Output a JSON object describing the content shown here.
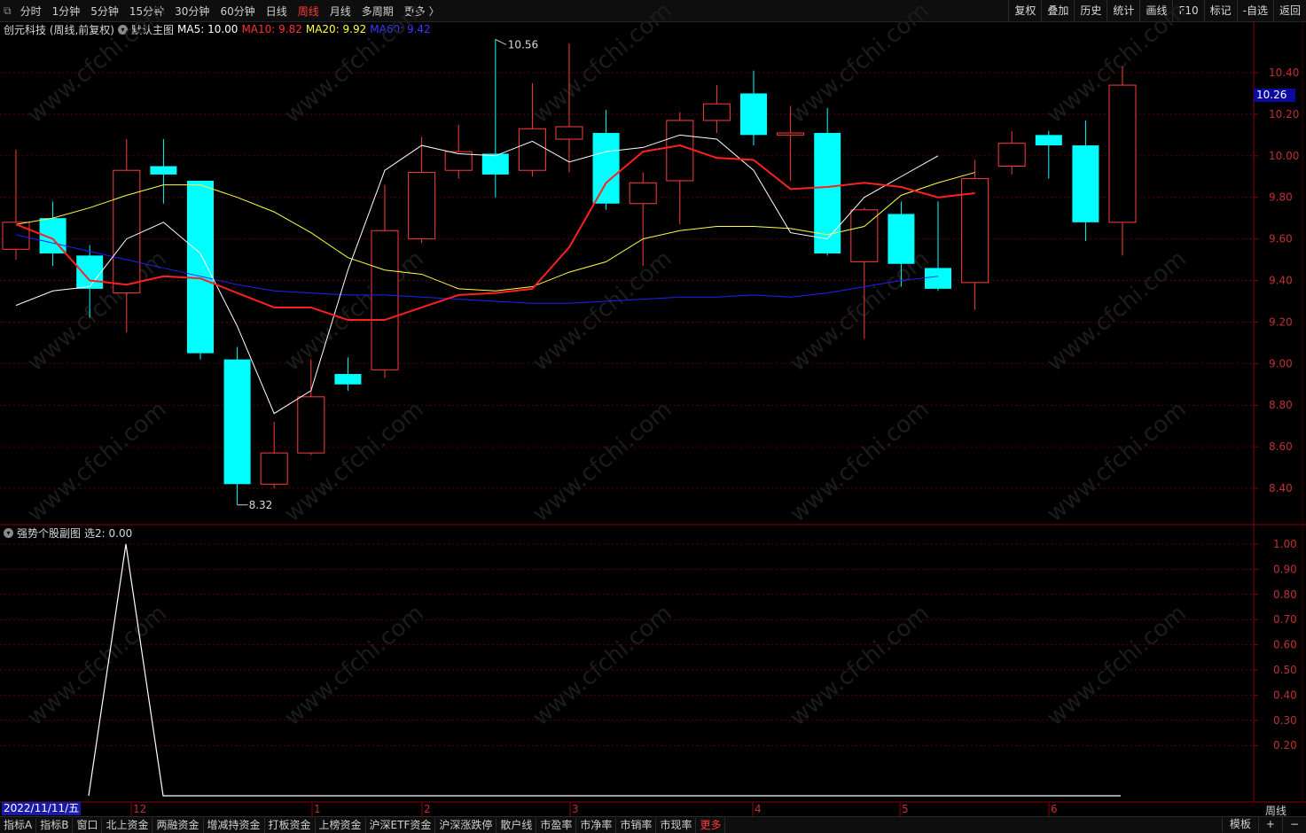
{
  "topbar": {
    "tabs": [
      "分时",
      "1分钟",
      "5分钟",
      "15分钟",
      "30分钟",
      "60分钟",
      "日线",
      "周线",
      "月线",
      "多周期",
      "更多 〉"
    ],
    "active_tab": "周线",
    "right_buttons": [
      "复权",
      "叠加",
      "历史",
      "统计",
      "画线",
      "F10",
      "标记",
      "-自选",
      "返回"
    ]
  },
  "legend": {
    "stock": "创元科技 (周线,前复权)",
    "template": "默认主图",
    "ma5": "MA5: 10.00",
    "ma10": "MA10: 9.82",
    "ma20": "MA20: 9.92",
    "ma60": "MA60: 9.42"
  },
  "sub_legend": {
    "name": "强势个股副图",
    "value": "选2: 0.00"
  },
  "current_price": "10.26",
  "high_label": "10.56",
  "low_label": "8.32",
  "date_cursor": "2022/11/11/五",
  "freq": "周线",
  "bottom_tabs": [
    "指标A",
    "指标B",
    "窗口",
    "北上资金",
    "两融资金",
    "增减持资金",
    "打板资金",
    "上榜资金",
    "沪深ETF资金",
    "沪深涨跌停",
    "散户线",
    "市盈率",
    "市净率",
    "市销率",
    "市现率",
    "更多"
  ],
  "bottom_right": [
    "模板",
    "+",
    "−"
  ],
  "colors": {
    "up": "#ff3b3b",
    "down": "#00ffff",
    "ma5": "#ffffff",
    "ma10": "#ff2020",
    "ma20": "#ffff40",
    "ma60": "#2020ff",
    "grid": "#5a0000"
  },
  "chart_data": {
    "type": "candlestick",
    "y_ticks": [
      "10.40",
      "10.20",
      "10.00",
      "9.80",
      "9.60",
      "9.40",
      "9.20",
      "9.00",
      "8.80",
      "8.60",
      "8.40"
    ],
    "x_ticks": [
      "12",
      "1",
      "2",
      "3",
      "4",
      "5",
      "6"
    ],
    "candles": [
      {
        "o": 9.55,
        "c": 9.68,
        "h": 10.03,
        "l": 9.5
      },
      {
        "o": 9.7,
        "c": 9.53,
        "h": 9.78,
        "l": 9.47
      },
      {
        "o": 9.52,
        "c": 9.36,
        "h": 9.57,
        "l": 9.22
      },
      {
        "o": 9.34,
        "c": 9.93,
        "h": 10.08,
        "l": 9.15
      },
      {
        "o": 9.95,
        "c": 9.91,
        "h": 10.08,
        "l": 9.77
      },
      {
        "o": 9.88,
        "c": 9.05,
        "h": 9.88,
        "l": 9.02
      },
      {
        "o": 9.02,
        "c": 8.42,
        "h": 9.08,
        "l": 8.32
      },
      {
        "o": 8.42,
        "c": 8.57,
        "h": 8.72,
        "l": 8.4
      },
      {
        "o": 8.57,
        "c": 8.84,
        "h": 9.02,
        "l": 8.56
      },
      {
        "o": 8.95,
        "c": 8.9,
        "h": 9.03,
        "l": 8.87
      },
      {
        "o": 8.97,
        "c": 9.64,
        "h": 9.86,
        "l": 8.93
      },
      {
        "o": 9.6,
        "c": 9.92,
        "h": 10.09,
        "l": 9.58
      },
      {
        "o": 9.93,
        "c": 10.02,
        "h": 10.15,
        "l": 9.89
      },
      {
        "o": 10.01,
        "c": 9.91,
        "h": 10.56,
        "l": 9.8
      },
      {
        "o": 9.93,
        "c": 10.13,
        "h": 10.35,
        "l": 9.9
      },
      {
        "o": 10.08,
        "c": 10.14,
        "h": 10.54,
        "l": 9.92
      },
      {
        "o": 10.11,
        "c": 9.77,
        "h": 10.22,
        "l": 9.74
      },
      {
        "o": 9.77,
        "c": 9.87,
        "h": 9.92,
        "l": 9.47
      },
      {
        "o": 9.88,
        "c": 10.17,
        "h": 10.21,
        "l": 9.67
      },
      {
        "o": 10.17,
        "c": 10.25,
        "h": 10.34,
        "l": 10.11
      },
      {
        "o": 10.3,
        "c": 10.1,
        "h": 10.41,
        "l": 10.05
      },
      {
        "o": 10.1,
        "c": 10.11,
        "h": 10.24,
        "l": 9.88
      },
      {
        "o": 10.11,
        "c": 9.53,
        "h": 10.23,
        "l": 9.52
      },
      {
        "o": 9.49,
        "c": 9.74,
        "h": 9.75,
        "l": 9.12
      },
      {
        "o": 9.72,
        "c": 9.48,
        "h": 9.78,
        "l": 9.37
      },
      {
        "o": 9.46,
        "c": 9.36,
        "h": 9.78,
        "l": 9.35
      },
      {
        "o": 9.39,
        "c": 9.89,
        "h": 9.98,
        "l": 9.26
      },
      {
        "o": 9.95,
        "c": 10.06,
        "h": 10.12,
        "l": 9.91
      },
      {
        "o": 10.1,
        "c": 10.05,
        "h": 10.12,
        "l": 9.89
      },
      {
        "o": 10.05,
        "c": 9.68,
        "h": 10.17,
        "l": 9.59
      },
      {
        "o": 9.68,
        "c": 10.34,
        "h": 10.43,
        "l": 9.52
      }
    ],
    "ma5": [
      9.28,
      9.35,
      9.37,
      9.6,
      9.68,
      9.53,
      9.18,
      8.76,
      8.87,
      9.45,
      9.93,
      10.05,
      10.01,
      10.0,
      10.07,
      9.97,
      10.02,
      10.04,
      10.1,
      10.08,
      9.93,
      9.63,
      9.6,
      9.8,
      9.9,
      10.0
    ],
    "ma10": [
      9.67,
      9.6,
      9.4,
      9.38,
      9.42,
      9.41,
      9.34,
      9.27,
      9.27,
      9.21,
      9.21,
      9.27,
      9.33,
      9.34,
      9.36,
      9.56,
      9.87,
      10.02,
      10.05,
      9.99,
      9.98,
      9.84,
      9.85,
      9.87,
      9.85,
      9.8,
      9.82
    ],
    "ma20": [
      9.67,
      9.7,
      9.75,
      9.81,
      9.86,
      9.86,
      9.8,
      9.73,
      9.63,
      9.51,
      9.45,
      9.43,
      9.36,
      9.35,
      9.37,
      9.44,
      9.49,
      9.6,
      9.64,
      9.66,
      9.66,
      9.65,
      9.62,
      9.66,
      9.81,
      9.87,
      9.92
    ],
    "ma60": [
      9.62,
      9.58,
      9.54,
      9.5,
      9.46,
      9.42,
      9.38,
      9.35,
      9.34,
      9.33,
      9.33,
      9.32,
      9.31,
      9.3,
      9.29,
      9.29,
      9.3,
      9.31,
      9.32,
      9.32,
      9.33,
      9.32,
      9.34,
      9.37,
      9.4,
      9.42
    ],
    "signal": {
      "y_ticks": [
        "1.00",
        "0.90",
        "0.80",
        "0.70",
        "0.60",
        "0.50",
        "0.40",
        "0.30",
        "0.20"
      ],
      "values": [
        0,
        0,
        0,
        1,
        0,
        0,
        0,
        0,
        0,
        0,
        0,
        0,
        0,
        0,
        0,
        0,
        0,
        0,
        0,
        0,
        0,
        0,
        0,
        0,
        0,
        0,
        0,
        0,
        0,
        0,
        0
      ]
    }
  }
}
